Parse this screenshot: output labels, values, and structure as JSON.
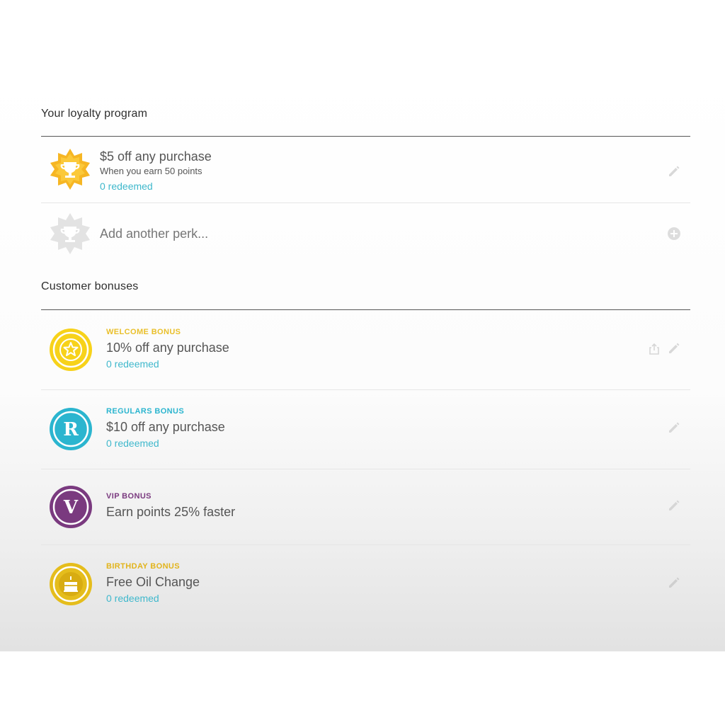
{
  "loyalty": {
    "heading": "Your loyalty program",
    "perk": {
      "title": "$5 off any purchase",
      "subtitle": "When you earn 50 points",
      "redeemed": "0 redeemed"
    },
    "add_perk_label": "Add another perk..."
  },
  "bonuses": {
    "heading": "Customer bonuses",
    "items": [
      {
        "tag": "WELCOME BONUS",
        "tag_color": "#e9bf2a",
        "title": "10% off any purchase",
        "redeemed": "0 redeemed",
        "badge_color": "#f7d21a",
        "badge_icon": "star-icon"
      },
      {
        "tag": "REGULARS BONUS",
        "tag_color": "#2bb5cf",
        "title": "$10 off any purchase",
        "redeemed": "0 redeemed",
        "badge_color": "#2bb5cf",
        "badge_letter": "R",
        "badge_icon": "letter-r-icon"
      },
      {
        "tag": "VIP BONUS",
        "tag_color": "#7a3a7f",
        "title": "Earn points 25% faster",
        "redeemed": "",
        "badge_color": "#7a3a7f",
        "badge_letter": "V",
        "badge_icon": "letter-v-icon"
      },
      {
        "tag": "BIRTHDAY BONUS",
        "tag_color": "#e2b41c",
        "title": "Free Oil Change",
        "redeemed": "0 redeemed",
        "badge_color": "#e5bd1c",
        "badge_icon": "cake-icon"
      }
    ]
  },
  "colors": {
    "accent_teal": "#3fb8cc",
    "trophy_gold": "#f6b623"
  }
}
